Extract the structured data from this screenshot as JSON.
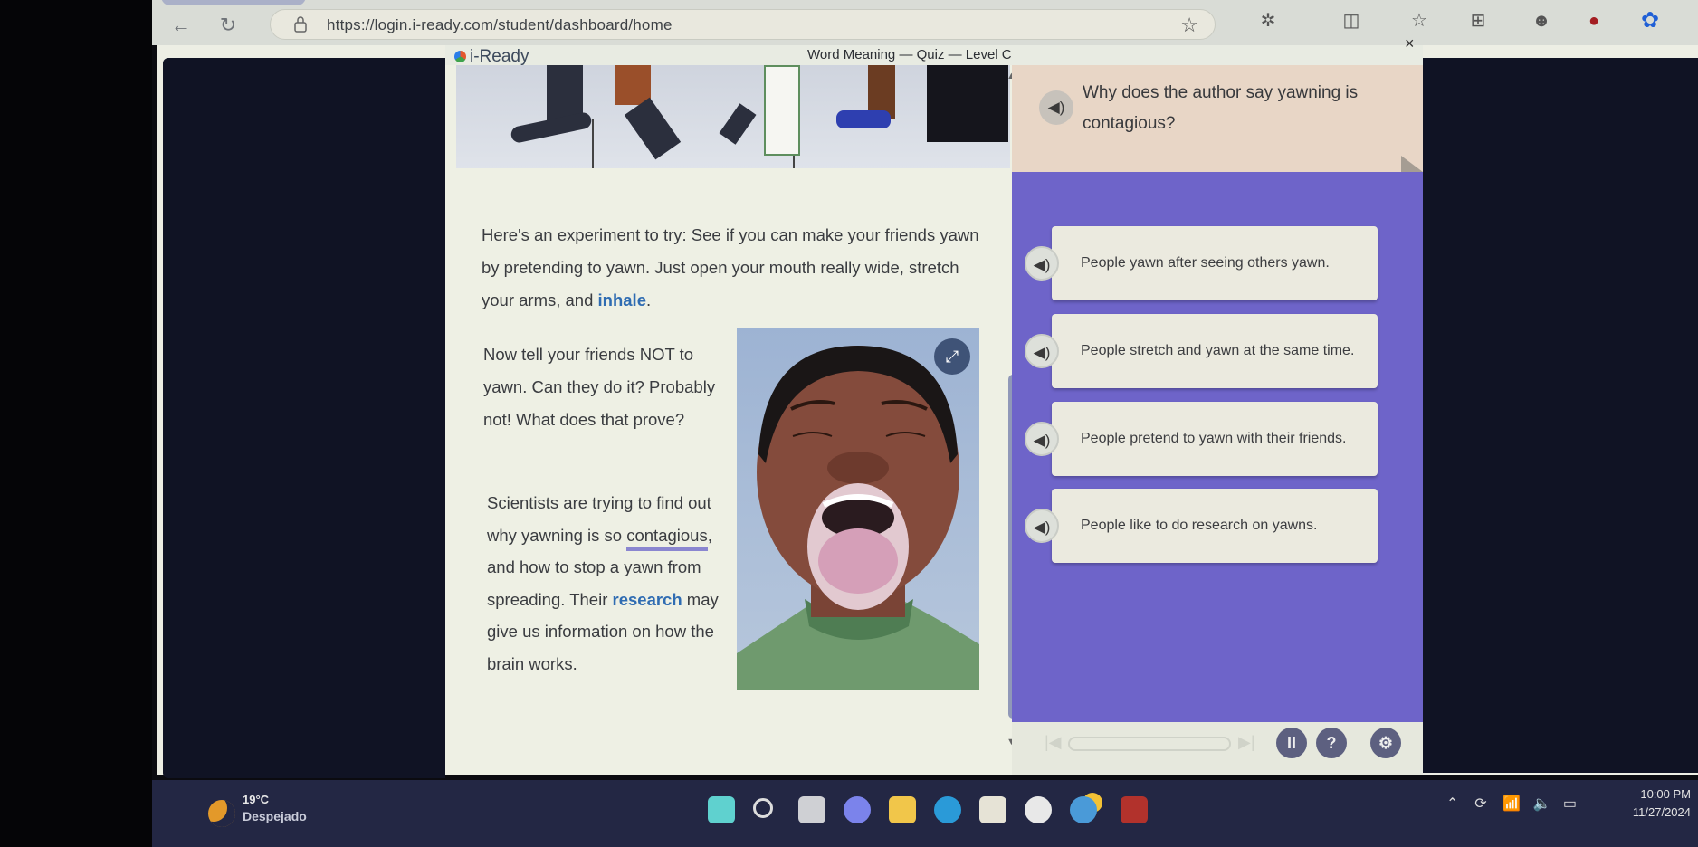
{
  "browser": {
    "url": "https://login.i-ready.com/student/dashboard/home",
    "icons": [
      "back-icon",
      "reload-icon",
      "lock-icon",
      "bookmark-star-icon",
      "extensions-icon",
      "split-screen-icon",
      "favorites-icon",
      "collections-icon",
      "profile-icon",
      "notification-badge-icon",
      "copilot-icon"
    ]
  },
  "app": {
    "logo": "i-Ready",
    "title": "Word Meaning — Quiz — Level C",
    "close_label": "×"
  },
  "passage": {
    "para1_before": "Here's an experiment to try: See if you can make your friends yawn by pretending to yawn. Just open your mouth really wide, stretch your arms, and ",
    "para1_vocab": "inhale",
    "para1_after": ".",
    "para2": "Now tell your friends NOT to yawn. Can they do it? Probably not! What does that prove?",
    "para3_before": "Scientists are trying to find out why yawning is so ",
    "para3_underlined": "contagious",
    "para3_mid": ", and how to stop a yawn from spreading. Their ",
    "para3_vocab": "research",
    "para3_after": " may give us information on how the brain works.",
    "image_alt": "Illustration of a person yawning"
  },
  "question": {
    "stem": "Why does the author say yawning is contagious?",
    "choices": [
      {
        "label": "People yawn after seeing others yawn."
      },
      {
        "label": "People stretch and yawn at the same time."
      },
      {
        "label": "People pretend to yawn with their friends."
      },
      {
        "label": "People like to do research on yawns."
      }
    ]
  },
  "controls": {
    "pause": "II",
    "help": "?",
    "settings": "⚙",
    "progress": 0
  },
  "taskbar": {
    "temperature": "19°C",
    "condition": "Despejado",
    "time": "10:00 PM",
    "date": "11/27/2024",
    "apps": [
      "start",
      "search",
      "task-view",
      "teams-chat",
      "file-explorer",
      "edge",
      "store",
      "kindle-app",
      "tips",
      "mcafee"
    ]
  },
  "colors": {
    "panel_purple": "#6e64c9",
    "vocab_blue": "#2f6cb2",
    "stem_bg": "#e8d6c6"
  }
}
